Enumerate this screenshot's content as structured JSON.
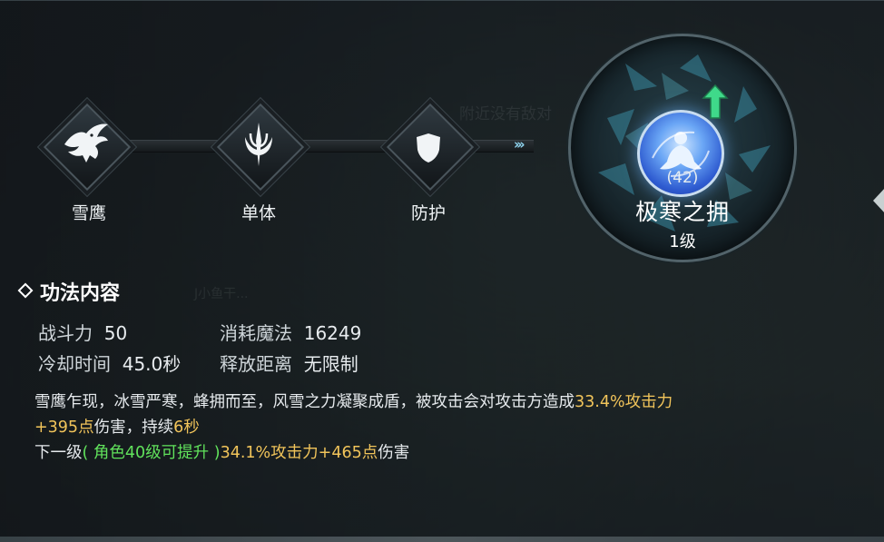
{
  "skill_chain": {
    "nodes": [
      {
        "label": "雪鹰",
        "icon": "eagle-icon"
      },
      {
        "label": "单体",
        "icon": "single-target-icon"
      },
      {
        "label": "防护",
        "icon": "shield-icon"
      }
    ],
    "arrows": "›››"
  },
  "skill": {
    "count": "(42)",
    "name": "极寒之拥",
    "level": "1级",
    "icon": "ice-meditation-orb-icon",
    "upgrade_icon": "upgrade-arrow-icon"
  },
  "section": {
    "title": "功法内容"
  },
  "stats": {
    "power_label": "战斗力",
    "power_value": "50",
    "mana_label": "消耗魔法",
    "mana_value": "16249",
    "cooldown_label": "冷却时间",
    "cooldown_value": "45.0秒",
    "range_label": "释放距离",
    "range_value": "无限制"
  },
  "description": {
    "line1_text": "雪鹰乍现，冰雪严寒，蜂拥而至，风雪之力凝聚成盾，被攻击会对攻击方造成",
    "line1_highlight": "33.4%攻击力",
    "line2_highlight1": "+395点",
    "line2_text1": "伤害，持续",
    "line2_highlight2": "6秒",
    "next_label": "下一级",
    "next_requirement": "( 角色40级可提升 )",
    "next_value": "34.1%攻击力+465点",
    "next_suffix": "伤害"
  },
  "background_text": {
    "t1": "附近没有敌对",
    "t2": "J小鱼干..."
  },
  "colors": {
    "highlight_gold": "#f1c45a",
    "requirement_green": "#61e35c",
    "arrow_cyan": "#8fd4ef",
    "upgrade_green": "#3fd98a"
  }
}
